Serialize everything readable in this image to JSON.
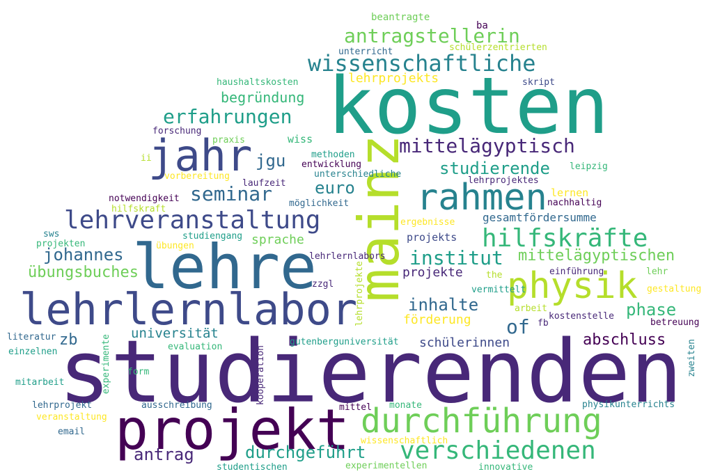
{
  "palette": {
    "indigo": "#482878",
    "darkpurple": "#440154",
    "slate": "#3e4a89",
    "blue": "#31688e",
    "steel": "#26828e",
    "teal": "#1f9e89",
    "green": "#35b779",
    "lime": "#6ece58",
    "yellowgreen": "#b5de2b",
    "yellow": "#fde725"
  },
  "words": [
    {
      "text": "studierenden",
      "color": "indigo",
      "orientation": "horizontal"
    },
    {
      "text": "kosten",
      "color": "teal",
      "orientation": "horizontal"
    },
    {
      "text": "lehre",
      "color": "blue",
      "orientation": "horizontal"
    },
    {
      "text": "mainz",
      "color": "yellowgreen",
      "orientation": "vertical"
    },
    {
      "text": "projekt",
      "color": "darkpurple",
      "orientation": "horizontal"
    },
    {
      "text": "lehrlernlabor",
      "color": "slate",
      "orientation": "horizontal"
    },
    {
      "text": "jahr",
      "color": "slate",
      "orientation": "horizontal"
    },
    {
      "text": "rahmen",
      "color": "steel",
      "orientation": "horizontal"
    },
    {
      "text": "physik",
      "color": "yellowgreen",
      "orientation": "horizontal"
    },
    {
      "text": "durchführung",
      "color": "lime",
      "orientation": "horizontal"
    },
    {
      "text": "lehrveranstaltung",
      "color": "slate",
      "orientation": "horizontal"
    },
    {
      "text": "verschiedenen",
      "color": "green",
      "orientation": "horizontal"
    },
    {
      "text": "hilfskräfte",
      "color": "green",
      "orientation": "horizontal"
    },
    {
      "text": "wissenschaftliche",
      "color": "steel",
      "orientation": "horizontal"
    },
    {
      "text": "mittelägyptisch",
      "color": "indigo",
      "orientation": "horizontal"
    },
    {
      "text": "antragstellerin",
      "color": "lime",
      "orientation": "horizontal"
    },
    {
      "text": "erfahrungen",
      "color": "teal",
      "orientation": "horizontal"
    },
    {
      "text": "seminar",
      "color": "blue",
      "orientation": "horizontal"
    },
    {
      "text": "institut",
      "color": "teal",
      "orientation": "horizontal"
    },
    {
      "text": "johannes",
      "color": "blue",
      "orientation": "horizontal"
    },
    {
      "text": "antrag",
      "color": "indigo",
      "orientation": "horizontal"
    },
    {
      "text": "durchgeführt",
      "color": "teal",
      "orientation": "horizontal"
    },
    {
      "text": "jgu",
      "color": "blue",
      "orientation": "horizontal"
    },
    {
      "text": "euro",
      "color": "steel",
      "orientation": "horizontal"
    },
    {
      "text": "studierende",
      "color": "teal",
      "orientation": "horizontal"
    },
    {
      "text": "mittelägyptischen",
      "color": "lime",
      "orientation": "horizontal"
    },
    {
      "text": "inhalte",
      "color": "blue",
      "orientation": "horizontal"
    },
    {
      "text": "phase",
      "color": "green",
      "orientation": "horizontal"
    },
    {
      "text": "of",
      "color": "blue",
      "orientation": "horizontal"
    },
    {
      "text": "abschluss",
      "color": "darkpurple",
      "orientation": "horizontal"
    },
    {
      "text": "übungsbuches",
      "color": "lime",
      "orientation": "horizontal"
    },
    {
      "text": "zb",
      "color": "blue",
      "orientation": "horizontal"
    },
    {
      "text": "begründung",
      "color": "green",
      "orientation": "horizontal"
    },
    {
      "text": "universität",
      "color": "steel",
      "orientation": "horizontal"
    },
    {
      "text": "sprache",
      "color": "lime",
      "orientation": "horizontal"
    },
    {
      "text": "projekte",
      "color": "indigo",
      "orientation": "horizontal"
    },
    {
      "text": "förderung",
      "color": "yellow",
      "orientation": "horizontal"
    },
    {
      "text": "schülerinnen",
      "color": "slate",
      "orientation": "horizontal"
    },
    {
      "text": "lehrprojekts",
      "color": "yellow",
      "orientation": "horizontal"
    },
    {
      "text": "gesamtfördersumme",
      "color": "blue",
      "orientation": "horizontal"
    },
    {
      "text": "projekts",
      "color": "slate",
      "orientation": "horizontal"
    },
    {
      "text": "lernen",
      "color": "yellow",
      "orientation": "horizontal"
    },
    {
      "text": "wiss",
      "color": "green",
      "orientation": "horizontal"
    },
    {
      "text": "beantragte",
      "color": "lime",
      "orientation": "horizontal"
    },
    {
      "text": "ba",
      "color": "darkpurple",
      "orientation": "horizontal"
    },
    {
      "text": "unterricht",
      "color": "blue",
      "orientation": "horizontal"
    },
    {
      "text": "schülerzentrierten",
      "color": "yellowgreen",
      "orientation": "horizontal"
    },
    {
      "text": "haushaltskosten",
      "color": "green",
      "orientation": "horizontal"
    },
    {
      "text": "skript",
      "color": "slate",
      "orientation": "horizontal"
    },
    {
      "text": "forschung",
      "color": "indigo",
      "orientation": "horizontal"
    },
    {
      "text": "praxis",
      "color": "lime",
      "orientation": "horizontal"
    },
    {
      "text": "methoden",
      "color": "teal",
      "orientation": "horizontal"
    },
    {
      "text": "ii",
      "color": "yellowgreen",
      "orientation": "horizontal"
    },
    {
      "text": "entwicklung",
      "color": "darkpurple",
      "orientation": "horizontal"
    },
    {
      "text": "unterschiedliche",
      "color": "steel",
      "orientation": "horizontal"
    },
    {
      "text": "vorbereitung",
      "color": "yellow",
      "orientation": "horizontal"
    },
    {
      "text": "leipzig",
      "color": "green",
      "orientation": "horizontal"
    },
    {
      "text": "laufzeit",
      "color": "indigo",
      "orientation": "horizontal"
    },
    {
      "text": "lehrprojektes",
      "color": "indigo",
      "orientation": "horizontal"
    },
    {
      "text": "notwendigkeit",
      "color": "darkpurple",
      "orientation": "horizontal"
    },
    {
      "text": "hilfskraft",
      "color": "yellowgreen",
      "orientation": "horizontal"
    },
    {
      "text": "möglichkeit",
      "color": "blue",
      "orientation": "horizontal"
    },
    {
      "text": "nachhaltig",
      "color": "darkpurple",
      "orientation": "horizontal"
    },
    {
      "text": "sws",
      "color": "steel",
      "orientation": "horizontal"
    },
    {
      "text": "projekten",
      "color": "green",
      "orientation": "horizontal"
    },
    {
      "text": "studiengang",
      "color": "teal",
      "orientation": "horizontal"
    },
    {
      "text": "ergebnisse",
      "color": "yellow",
      "orientation": "horizontal"
    },
    {
      "text": "übungen",
      "color": "yellow",
      "orientation": "horizontal"
    },
    {
      "text": "lehrlernlabors",
      "color": "indigo",
      "orientation": "horizontal"
    },
    {
      "text": "einführung",
      "color": "indigo",
      "orientation": "horizontal"
    },
    {
      "text": "lehr",
      "color": "lime",
      "orientation": "horizontal"
    },
    {
      "text": "the",
      "color": "yellowgreen",
      "orientation": "horizontal"
    },
    {
      "text": "zzgl",
      "color": "indigo",
      "orientation": "horizontal"
    },
    {
      "text": "lehrprojekte",
      "color": "yellowgreen",
      "orientation": "vertical"
    },
    {
      "text": "vermittelt",
      "color": "teal",
      "orientation": "horizontal"
    },
    {
      "text": "gestaltung",
      "color": "yellow",
      "orientation": "horizontal"
    },
    {
      "text": "arbeit",
      "color": "yellowgreen",
      "orientation": "horizontal"
    },
    {
      "text": "kostenstelle",
      "color": "indigo",
      "orientation": "horizontal"
    },
    {
      "text": "fb",
      "color": "indigo",
      "orientation": "horizontal"
    },
    {
      "text": "betreuung",
      "color": "darkpurple",
      "orientation": "horizontal"
    },
    {
      "text": "literatur",
      "color": "blue",
      "orientation": "horizontal"
    },
    {
      "text": "gutenberguniversität",
      "color": "teal",
      "orientation": "horizontal"
    },
    {
      "text": "evaluation",
      "color": "green",
      "orientation": "horizontal"
    },
    {
      "text": "einzelnen",
      "color": "teal",
      "orientation": "horizontal"
    },
    {
      "text": "experimente",
      "color": "green",
      "orientation": "vertical"
    },
    {
      "text": "kooperation",
      "color": "indigo",
      "orientation": "vertical"
    },
    {
      "text": "zweiten",
      "color": "steel",
      "orientation": "vertical"
    },
    {
      "text": "form",
      "color": "green",
      "orientation": "horizontal"
    },
    {
      "text": "mitarbeit",
      "color": "teal",
      "orientation": "horizontal"
    },
    {
      "text": "lehrprojekt",
      "color": "blue",
      "orientation": "horizontal"
    },
    {
      "text": "ausschreibung",
      "color": "blue",
      "orientation": "horizontal"
    },
    {
      "text": "mittel",
      "color": "darkpurple",
      "orientation": "horizontal"
    },
    {
      "text": "monate",
      "color": "green",
      "orientation": "horizontal"
    },
    {
      "text": "physikunterrichts",
      "color": "steel",
      "orientation": "horizontal"
    },
    {
      "text": "veranstaltung",
      "color": "yellow",
      "orientation": "horizontal"
    },
    {
      "text": "email",
      "color": "blue",
      "orientation": "horizontal"
    },
    {
      "text": "wissenschaftlich",
      "color": "yellow",
      "orientation": "horizontal"
    },
    {
      "text": "studentischen",
      "color": "teal",
      "orientation": "horizontal"
    },
    {
      "text": "experimentellen",
      "color": "lime",
      "orientation": "horizontal"
    },
    {
      "text": "innovative",
      "color": "green",
      "orientation": "horizontal"
    }
  ]
}
